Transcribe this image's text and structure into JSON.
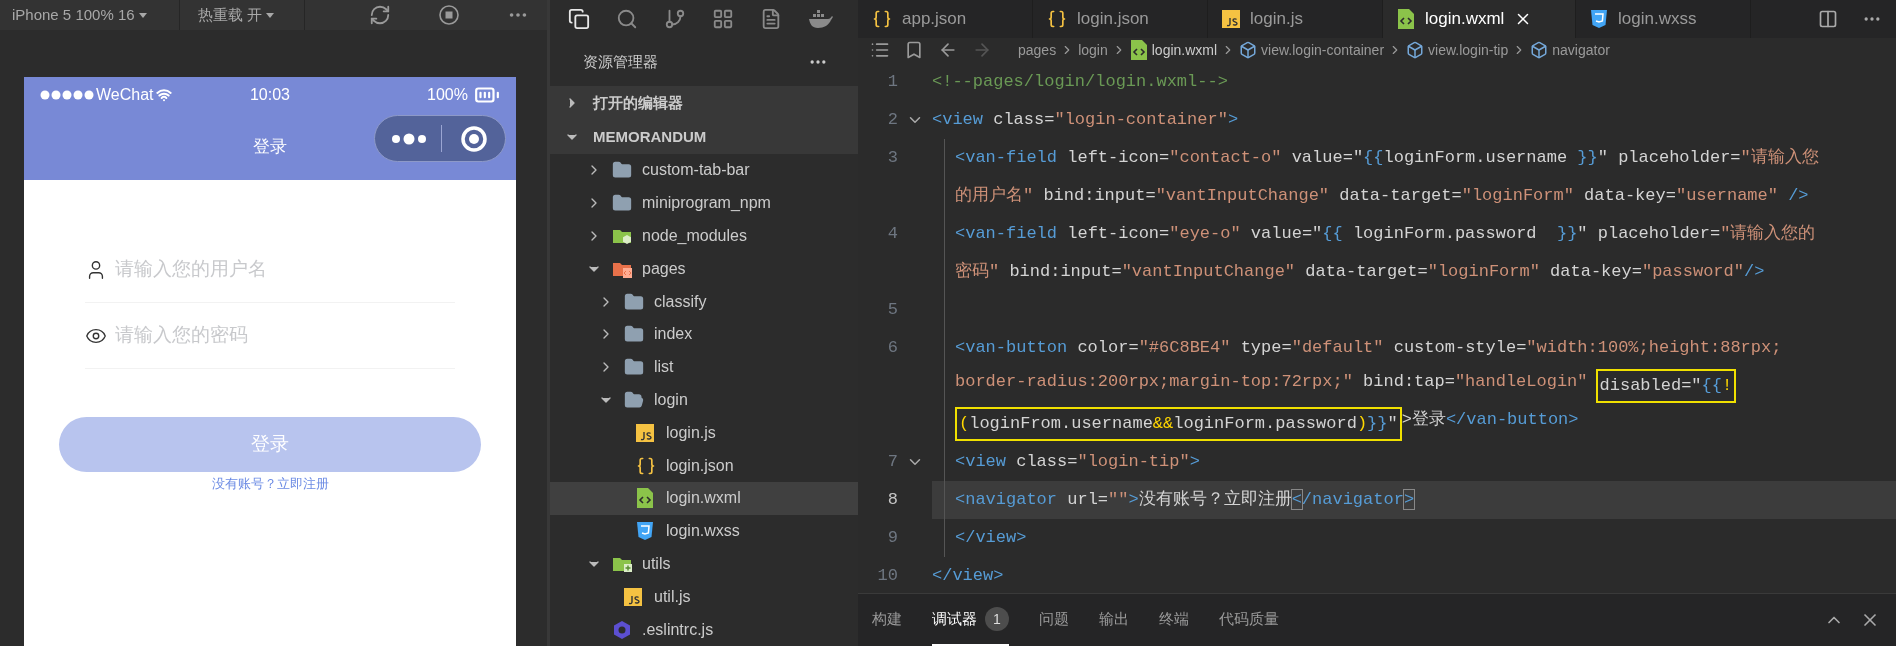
{
  "simulator": {
    "toolbar": {
      "device": "iPhone 5 100% 16",
      "hot_reload": "热重载 开"
    },
    "phone": {
      "carrier": "WeChat",
      "time": "10:03",
      "battery": "100%",
      "title": "登录",
      "fields": [
        {
          "kind": "contact",
          "placeholder": "请输入您的用户名"
        },
        {
          "kind": "eye",
          "placeholder": "请输入您的密码"
        }
      ],
      "button": {
        "label": "登录",
        "disabled": true
      },
      "link": "没有账号？立即注册"
    }
  },
  "explorer": {
    "title": "资源管理器",
    "sections": [
      {
        "label": "打开的编辑器",
        "expanded": false
      },
      {
        "label": "MEMORANDUM",
        "expanded": true,
        "children": [
          {
            "label": "custom-tab-bar",
            "kind": "folder",
            "expanded": false,
            "selected": false
          },
          {
            "label": "miniprogram_npm",
            "kind": "folder",
            "expanded": false,
            "selected": false
          },
          {
            "label": "node_modules",
            "kind": "node-folder",
            "expanded": false,
            "selected": false
          },
          {
            "label": "pages",
            "kind": "pages-folder",
            "expanded": true,
            "selected": false,
            "children": [
              {
                "label": "classify",
                "kind": "folder",
                "expanded": false,
                "selected": false
              },
              {
                "label": "index",
                "kind": "folder",
                "expanded": false,
                "selected": false
              },
              {
                "label": "list",
                "kind": "folder",
                "expanded": false,
                "selected": false
              },
              {
                "label": "login",
                "kind": "folder",
                "expanded": true,
                "selected": false,
                "children": [
                  {
                    "label": "login.js",
                    "kind": "js",
                    "selected": false
                  },
                  {
                    "label": "login.json",
                    "kind": "json",
                    "selected": false
                  },
                  {
                    "label": "login.wxml",
                    "kind": "wxml",
                    "selected": true
                  },
                  {
                    "label": "login.wxss",
                    "kind": "wxss",
                    "selected": false
                  }
                ]
              }
            ]
          },
          {
            "label": "utils",
            "kind": "utils-folder",
            "expanded": true,
            "selected": false,
            "children": [
              {
                "label": "util.js",
                "kind": "js",
                "selected": false
              }
            ]
          },
          {
            "label": ".eslintrc.js",
            "kind": "eslint",
            "selected": false
          }
        ]
      }
    ]
  },
  "editor": {
    "tabs": [
      {
        "label": "app.json",
        "kind": "json",
        "selected": false
      },
      {
        "label": "login.json",
        "kind": "json",
        "selected": false
      },
      {
        "label": "login.js",
        "kind": "js",
        "selected": false
      },
      {
        "label": "login.wxml",
        "kind": "wxml",
        "selected": true
      },
      {
        "label": "login.wxss",
        "kind": "wxss",
        "selected": false
      }
    ],
    "breadcrumbs": [
      {
        "label": "pages",
        "kind": "folder"
      },
      {
        "label": "login",
        "kind": "folder"
      },
      {
        "label": "login.wxml",
        "kind": "wxml"
      },
      {
        "label": "view.login-container",
        "kind": "element"
      },
      {
        "label": "view.login-tip",
        "kind": "element"
      },
      {
        "label": "navigator",
        "kind": "element"
      }
    ],
    "lines": [
      {
        "number": "1",
        "current": false,
        "rows": [
          {
            "parts": [
              {
                "kind": "comment",
                "text": "<!--pages/login/login.wxml-->"
              }
            ]
          }
        ]
      },
      {
        "number": "2",
        "fold_open": true,
        "current": false,
        "rows": [
          {
            "parts": [
              {
                "kind": "tag",
                "text": "<view"
              },
              {
                "kind": "text",
                "text": " class="
              },
              {
                "kind": "string",
                "text": "\"login-container\""
              },
              {
                "kind": "tag",
                "text": ">"
              }
            ]
          }
        ],
        "children": [
          {
            "number": "3",
            "current": false,
            "rows": [
              {
                "parts": [
                  {
                    "kind": "tag",
                    "text": "<van-field"
                  },
                  {
                    "kind": "text",
                    "text": " left-icon="
                  },
                  {
                    "kind": "string",
                    "text": "\"contact-o\""
                  },
                  {
                    "kind": "text",
                    "text": " value=\""
                  },
                  {
                    "kind": "brace",
                    "text": "{{"
                  },
                  {
                    "kind": "text",
                    "text": "loginForm.username "
                  },
                  {
                    "kind": "brace",
                    "text": "}}"
                  },
                  {
                    "kind": "text",
                    "text": "\" placeholder="
                  },
                  {
                    "kind": "string",
                    "text": "\"请输入您"
                  }
                ]
              },
              {
                "parts": [
                  {
                    "kind": "string",
                    "text": "的用户名\""
                  },
                  {
                    "kind": "text",
                    "text": " bind:input="
                  },
                  {
                    "kind": "string",
                    "text": "\"vantInputChange\""
                  },
                  {
                    "kind": "text",
                    "text": " data-target="
                  },
                  {
                    "kind": "string",
                    "text": "\"loginForm\""
                  },
                  {
                    "kind": "text",
                    "text": " data-key="
                  },
                  {
                    "kind": "string",
                    "text": "\"username\""
                  },
                  {
                    "kind": "tag",
                    "text": " />"
                  }
                ]
              }
            ]
          },
          {
            "number": "4",
            "current": false,
            "rows": [
              {
                "parts": [
                  {
                    "kind": "tag",
                    "text": "<van-field"
                  },
                  {
                    "kind": "text",
                    "text": " left-icon="
                  },
                  {
                    "kind": "string",
                    "text": "\"eye-o\""
                  },
                  {
                    "kind": "text",
                    "text": " value=\""
                  },
                  {
                    "kind": "brace",
                    "text": "{{"
                  },
                  {
                    "kind": "text",
                    "text": " loginForm.password  "
                  },
                  {
                    "kind": "brace",
                    "text": "}}"
                  },
                  {
                    "kind": "text",
                    "text": "\" placeholder="
                  },
                  {
                    "kind": "string",
                    "text": "\"请输入您的"
                  }
                ]
              },
              {
                "parts": [
                  {
                    "kind": "string",
                    "text": "密码\""
                  },
                  {
                    "kind": "text",
                    "text": " bind:input="
                  },
                  {
                    "kind": "string",
                    "text": "\"vantInputChange\""
                  },
                  {
                    "kind": "text",
                    "text": " data-target="
                  },
                  {
                    "kind": "string",
                    "text": "\"loginForm\""
                  },
                  {
                    "kind": "text",
                    "text": " data-key="
                  },
                  {
                    "kind": "string",
                    "text": "\"password\""
                  },
                  {
                    "kind": "tag",
                    "text": "/>"
                  }
                ]
              }
            ]
          },
          {
            "number": "5",
            "current": false
          },
          {
            "number": "6",
            "current": false,
            "rows": [
              {
                "parts": [
                  {
                    "kind": "tag",
                    "text": "<van-button"
                  },
                  {
                    "kind": "text",
                    "text": " color="
                  },
                  {
                    "kind": "string",
                    "text": "\"#6C8BE4\""
                  },
                  {
                    "kind": "text",
                    "text": " type="
                  },
                  {
                    "kind": "string",
                    "text": "\"default\""
                  },
                  {
                    "kind": "text",
                    "text": " custom-style="
                  },
                  {
                    "kind": "string",
                    "text": "\"width:100%;height:88rpx;"
                  }
                ]
              },
              {
                "parts": [
                  {
                    "kind": "string",
                    "text": "border-radius:200rpx;margin-top:72rpx;\""
                  },
                  {
                    "kind": "text",
                    "text": " bind:tap="
                  },
                  {
                    "kind": "string",
                    "text": "\"handleLogin\""
                  },
                  {
                    "kind": "box",
                    "parts": [
                      {
                        "kind": "text",
                        "text": "disabled=\""
                      },
                      {
                        "kind": "brace",
                        "text": "{{"
                      },
                      {
                        "kind": "op",
                        "text": "!"
                      }
                    ]
                  }
                ]
              },
              {
                "parts": [
                  {
                    "kind": "box",
                    "parts": [
                      {
                        "kind": "op",
                        "text": "("
                      },
                      {
                        "kind": "text",
                        "text": "loginFrom.username"
                      },
                      {
                        "kind": "op",
                        "text": "&&"
                      },
                      {
                        "kind": "text",
                        "text": "loginForm.password"
                      },
                      {
                        "kind": "op",
                        "text": ")"
                      },
                      {
                        "kind": "brace",
                        "text": "}}"
                      },
                      {
                        "kind": "text",
                        "text": "\""
                      }
                    ]
                  },
                  {
                    "kind": "text",
                    "text": ">登录"
                  },
                  {
                    "kind": "tag",
                    "text": "</van-button>"
                  }
                ]
              }
            ]
          },
          {
            "number": "7",
            "fold_open": true,
            "current": false,
            "rows": [
              {
                "parts": [
                  {
                    "kind": "tag",
                    "text": "<view"
                  },
                  {
                    "kind": "text",
                    "text": " class="
                  },
                  {
                    "kind": "string",
                    "text": "\"login-tip\""
                  },
                  {
                    "kind": "tag",
                    "text": ">"
                  }
                ]
              }
            ]
          },
          {
            "number": "8",
            "current": true,
            "rows": [
              {
                "parts": [
                  {
                    "kind": "tag",
                    "text": "<navigator"
                  },
                  {
                    "kind": "text",
                    "text": " url="
                  },
                  {
                    "kind": "string",
                    "text": "\"\""
                  },
                  {
                    "kind": "tag",
                    "text": ">"
                  },
                  {
                    "kind": "text",
                    "text": "没有账号？立即注册"
                  },
                  {
                    "kind": "matched",
                    "text": "<"
                  },
                  {
                    "kind": "tag",
                    "text": "/navigator"
                  },
                  {
                    "kind": "matched",
                    "text": ">"
                  }
                ]
              }
            ]
          },
          {
            "number": "9",
            "current": false,
            "rows": [
              {
                "parts": [
                  {
                    "kind": "tag",
                    "text": "</view>"
                  }
                ]
              }
            ]
          }
        ]
      },
      {
        "number": "10",
        "current": false,
        "rows": [
          {
            "parts": [
              {
                "kind": "tag",
                "text": "</view>"
              }
            ]
          }
        ]
      }
    ]
  },
  "panel": {
    "tabs": [
      {
        "label": "构建",
        "selected": false
      },
      {
        "label": "调试器",
        "selected": true,
        "badge": "1"
      },
      {
        "label": "问题",
        "selected": false
      },
      {
        "label": "输出",
        "selected": false
      },
      {
        "label": "终端",
        "selected": false
      },
      {
        "label": "代码质量",
        "selected": false
      }
    ]
  }
}
